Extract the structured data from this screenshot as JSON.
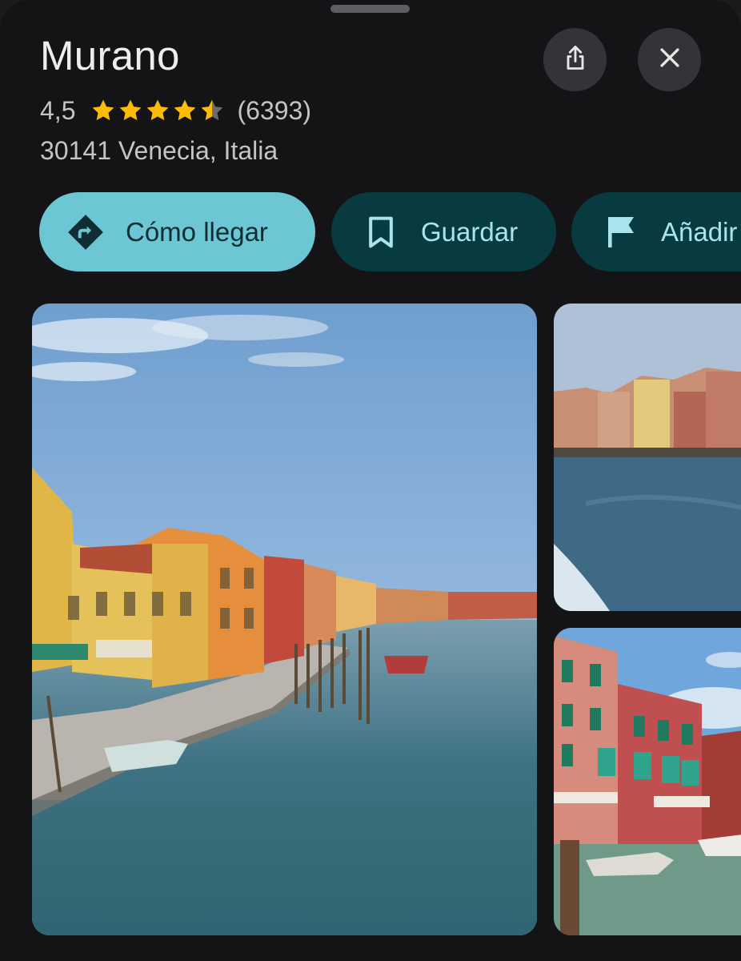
{
  "place": {
    "name": "Murano",
    "rating": "4,5",
    "rating_value": 4.5,
    "stars_max": 5,
    "review_count": "(6393)",
    "address": "30141 Venecia, Italia"
  },
  "actions": {
    "directions_label": "Cómo llegar",
    "save_label": "Guardar",
    "add_label": "Añadir"
  },
  "icons": {
    "share": "share-icon",
    "close": "close-icon",
    "directions": "directions-icon",
    "save": "bookmark-icon",
    "add": "flag-icon",
    "star": "star-icon"
  },
  "colors": {
    "background": "#141416",
    "star": "#fbbc04",
    "primary_chip": "#6cc6d3",
    "secondary_chip": "#073b3f",
    "secondary_chip_text": "#a9e4ec"
  },
  "photos": [
    {
      "subject": "murano-canal-street"
    },
    {
      "subject": "lagoon-view"
    },
    {
      "subject": "colorful-houses-canal"
    }
  ]
}
